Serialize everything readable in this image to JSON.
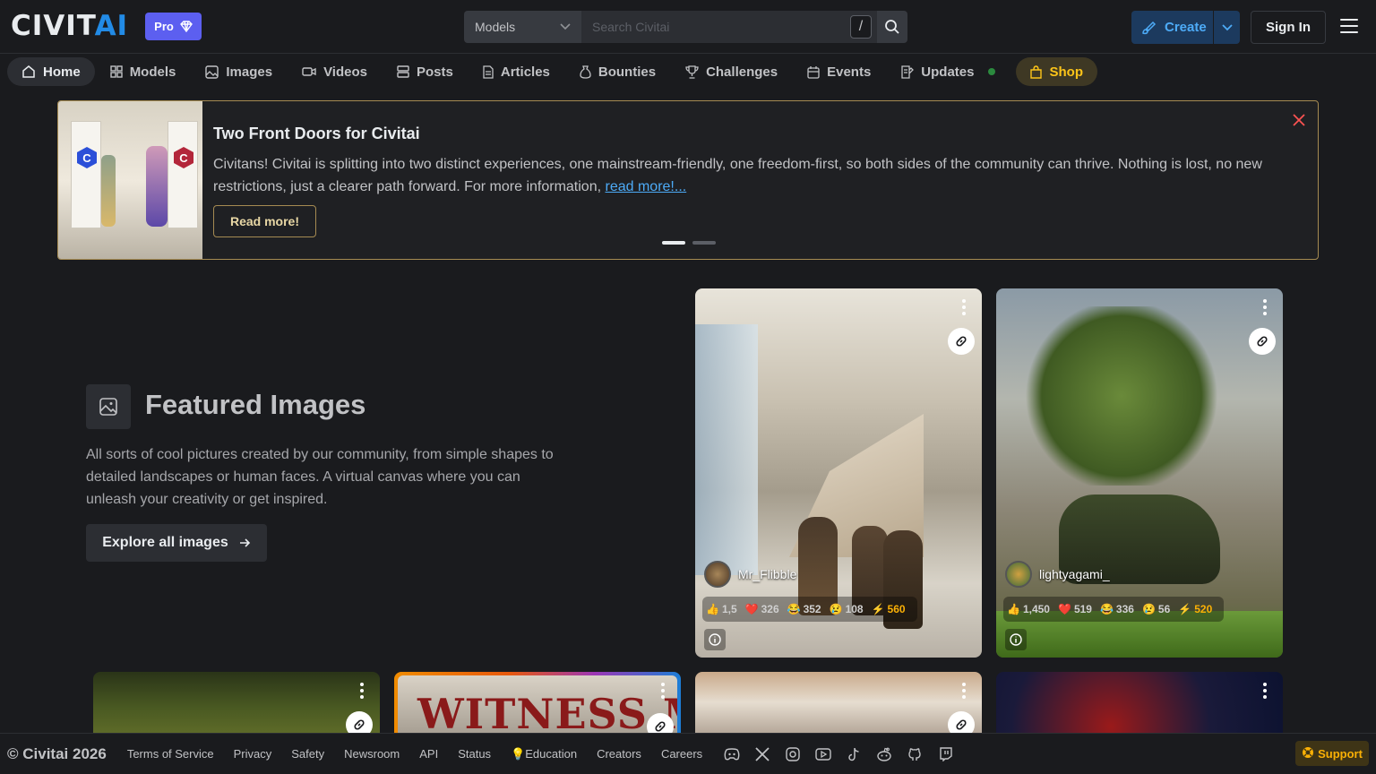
{
  "brand": {
    "logo_part1": "CIVIT",
    "logo_part2": "AI",
    "pro_label": "Pro"
  },
  "search": {
    "scope": "Models",
    "placeholder": "Search Civitai",
    "shortcut": "/"
  },
  "header": {
    "create_label": "Create",
    "signin_label": "Sign In"
  },
  "nav": {
    "items": [
      "Home",
      "Models",
      "Images",
      "Videos",
      "Posts",
      "Articles",
      "Bounties",
      "Challenges",
      "Events",
      "Updates",
      "Shop"
    ]
  },
  "announcement": {
    "title": "Two Front Doors for Civitai",
    "body": "Civitans! Civitai is splitting into two distinct experiences, one mainstream-friendly, one freedom-first, so both sides of the community can thrive. Nothing is lost, no new restrictions, just a clearer path forward. For more information, ",
    "link_text": "read more!...",
    "button_label": "Read more!",
    "door_letter": "C"
  },
  "featured": {
    "title": "Featured Images",
    "description": "All sorts of cool pictures created by our community, from simple shapes to detailed landscapes or human faces. A virtual canvas where you can unleash your creativity or get inspired.",
    "button_label": "Explore all images"
  },
  "cards": [
    {
      "user": "Mr_Flibble",
      "likes": "1,5",
      "hearts": "326",
      "laughs": "352",
      "cries": "108",
      "buzz": "560"
    },
    {
      "user": "lightyagami_",
      "likes": "1,450",
      "hearts": "519",
      "laughs": "336",
      "cries": "56",
      "buzz": "520"
    }
  ],
  "witness_text": "WITNESS ME",
  "footer": {
    "copyright": "© Civitai 2026",
    "links": [
      "Terms of Service",
      "Privacy",
      "Safety",
      "Newsroom",
      "API",
      "Status",
      "Education",
      "Creators",
      "Careers"
    ],
    "education_icon": "💡",
    "support_label": "Support"
  },
  "colors": {
    "accent": "#228be6",
    "pro": "#5c5ff0",
    "gold": "#fcc419",
    "banner_border": "#a68b52",
    "bg": "#1a1b1e"
  }
}
